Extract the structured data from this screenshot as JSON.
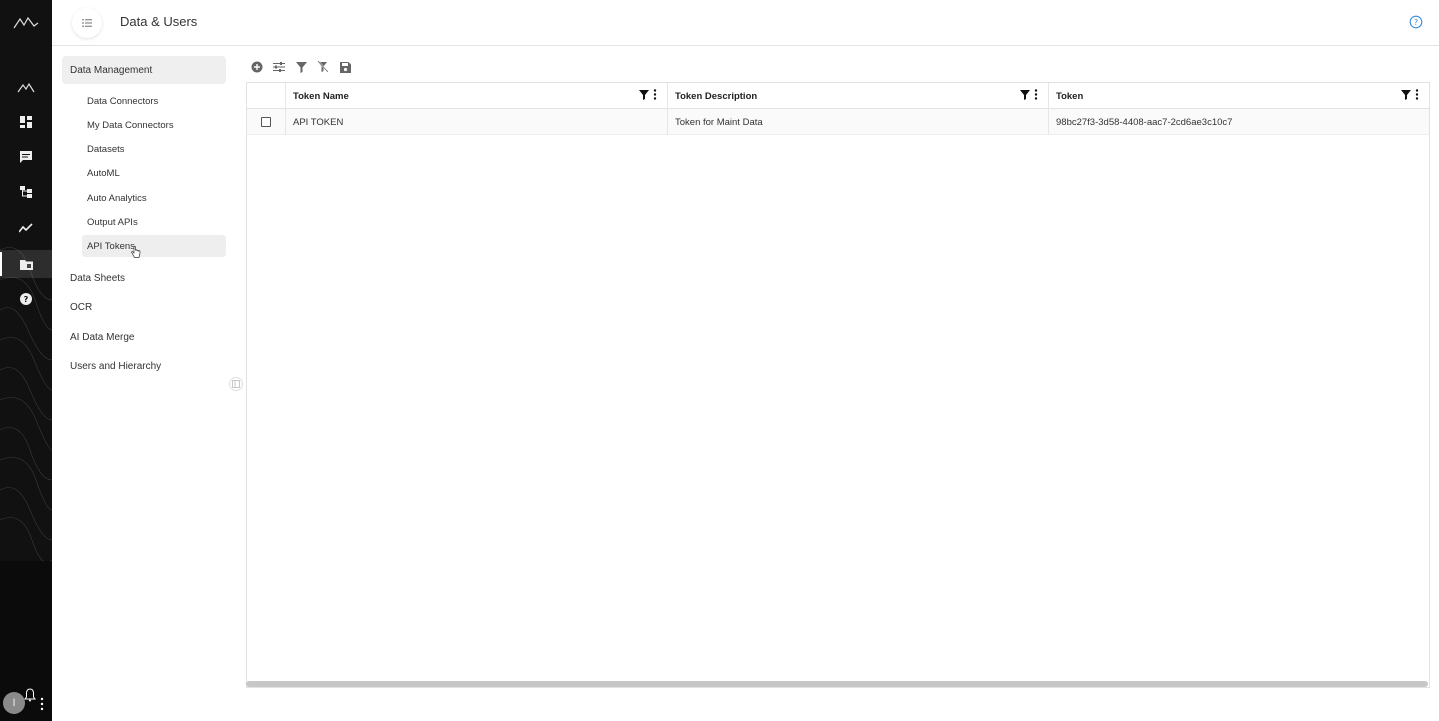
{
  "app": {
    "page_title": "Data & Users"
  },
  "rail": {
    "avatar_letter": "I",
    "icons": [
      "logo-icon",
      "mountains-icon",
      "dashboard-icon",
      "chat-icon",
      "hierarchy-icon",
      "trend-icon",
      "folder-icon",
      "help-icon"
    ]
  },
  "subnav": {
    "sections": [
      {
        "label": "Data Management",
        "selected": true
      },
      {
        "label": "Data Sheets"
      },
      {
        "label": "OCR"
      },
      {
        "label": "AI Data Merge"
      },
      {
        "label": "Users and Hierarchy"
      }
    ],
    "items": [
      {
        "label": "Data Connectors"
      },
      {
        "label": "My Data Connectors"
      },
      {
        "label": "Datasets"
      },
      {
        "label": "AutoML"
      },
      {
        "label": "Auto Analytics"
      },
      {
        "label": "Output APIs"
      },
      {
        "label": "API Tokens",
        "active": true
      }
    ]
  },
  "toolbar": {
    "icons": [
      "add-icon",
      "columns-icon",
      "filter-icon",
      "clear-filter-icon",
      "save-icon"
    ]
  },
  "grid": {
    "columns": [
      "Token Name",
      "Token Description",
      "Token"
    ],
    "rows": [
      {
        "name": "API TOKEN",
        "description": "Token for Maint Data",
        "token": "98bc27f3-3d58-4408-aac7-2cd6ae3c10c7"
      }
    ]
  },
  "colors": {
    "rail_bg": "#111111",
    "selected_bg": "#efefef",
    "accent_help": "#3b8fd9"
  }
}
